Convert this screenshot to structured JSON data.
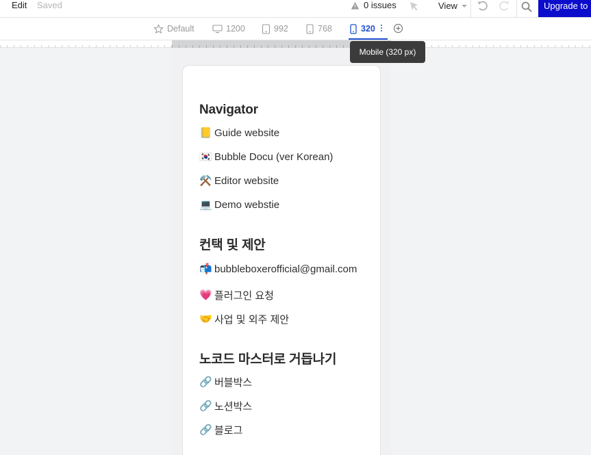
{
  "toolbar": {
    "edit_label": "Edit",
    "saved_label": "Saved",
    "issues_label": "0 issues",
    "view_label": "View",
    "upgrade_label": "Upgrade to"
  },
  "breakpoints": {
    "default_label": "Default",
    "bp_1200": "1200",
    "bp_992": "992",
    "bp_768": "768",
    "bp_320": "320",
    "tooltip": "Mobile (320 px)"
  },
  "content": {
    "navigator": {
      "title": "Navigator",
      "items": [
        {
          "emoji": "📒",
          "label": "Guide website"
        },
        {
          "emoji": "🇰🇷",
          "label": "Bubble Docu (ver Korean)"
        },
        {
          "emoji": "⚒️",
          "label": "Editor website"
        },
        {
          "emoji": "💻",
          "label": "Demo webstie"
        }
      ]
    },
    "contact": {
      "title": "컨택 및 제안",
      "items": [
        {
          "emoji": "📬",
          "label": "bubbleboxerofficial@gmail.com"
        },
        {
          "emoji": "💗",
          "label": "플러그인 요청"
        },
        {
          "emoji": "🤝",
          "label": "사업 및 외주 제안"
        }
      ]
    },
    "nocode": {
      "title": "노코드 마스터로 거듭나기",
      "items": [
        {
          "emoji": "🔗",
          "label": "버블박스"
        },
        {
          "emoji": "🔗",
          "label": "노션박스"
        },
        {
          "emoji": "🔗",
          "label": "블로그"
        }
      ]
    }
  },
  "colors": {
    "accent": "#1f4fd1",
    "upgrade_bg": "#0c0ccc",
    "tooltip_bg": "#3b3b3b"
  }
}
